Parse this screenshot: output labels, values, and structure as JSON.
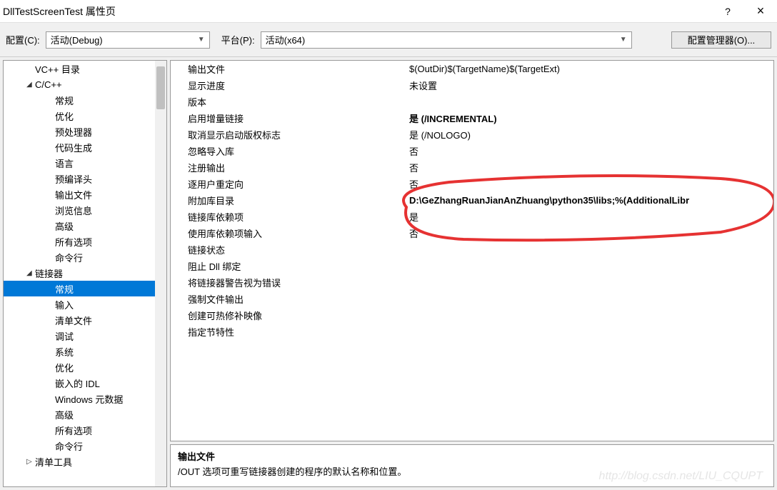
{
  "titlebar": {
    "title": "DllTestScreenTest 属性页",
    "help": "?",
    "close": "×"
  },
  "toolbar": {
    "config_label": "配置(C):",
    "config_value": "活动(Debug)",
    "platform_label": "平台(P):",
    "platform_value": "活动(x64)",
    "manager_button": "配置管理器(O)..."
  },
  "tree": [
    {
      "label": "VC++ 目录",
      "level": 1
    },
    {
      "label": "C/C++",
      "level": 1,
      "arrow": "◢"
    },
    {
      "label": "常规",
      "level": 3
    },
    {
      "label": "优化",
      "level": 3
    },
    {
      "label": "预处理器",
      "level": 3
    },
    {
      "label": "代码生成",
      "level": 3
    },
    {
      "label": "语言",
      "level": 3
    },
    {
      "label": "预编译头",
      "level": 3
    },
    {
      "label": "输出文件",
      "level": 3
    },
    {
      "label": "浏览信息",
      "level": 3
    },
    {
      "label": "高级",
      "level": 3
    },
    {
      "label": "所有选项",
      "level": 3
    },
    {
      "label": "命令行",
      "level": 3
    },
    {
      "label": "链接器",
      "level": 1,
      "arrow": "◢"
    },
    {
      "label": "常规",
      "level": 3,
      "selected": true
    },
    {
      "label": "输入",
      "level": 3
    },
    {
      "label": "清单文件",
      "level": 3
    },
    {
      "label": "调试",
      "level": 3
    },
    {
      "label": "系统",
      "level": 3
    },
    {
      "label": "优化",
      "level": 3
    },
    {
      "label": "嵌入的 IDL",
      "level": 3
    },
    {
      "label": "Windows 元数据",
      "level": 3
    },
    {
      "label": "高级",
      "level": 3
    },
    {
      "label": "所有选项",
      "level": 3
    },
    {
      "label": "命令行",
      "level": 3
    },
    {
      "label": "清单工具",
      "level": 1,
      "arrow": "▷"
    }
  ],
  "props": [
    {
      "label": "输出文件",
      "value": "$(OutDir)$(TargetName)$(TargetExt)"
    },
    {
      "label": "显示进度",
      "value": "未设置"
    },
    {
      "label": "版本",
      "value": ""
    },
    {
      "label": "启用增量链接",
      "value": "是 (/INCREMENTAL)",
      "bold": true
    },
    {
      "label": "取消显示启动版权标志",
      "value": "是 (/NOLOGO)"
    },
    {
      "label": "忽略导入库",
      "value": "否"
    },
    {
      "label": "注册输出",
      "value": "否"
    },
    {
      "label": "逐用户重定向",
      "value": "否"
    },
    {
      "label": "附加库目录",
      "value": "D:\\GeZhangRuanJianAnZhuang\\python35\\libs;%(AdditionalLibr",
      "bold": true
    },
    {
      "label": "链接库依赖项",
      "value": "是"
    },
    {
      "label": "使用库依赖项输入",
      "value": "否"
    },
    {
      "label": "链接状态",
      "value": ""
    },
    {
      "label": "阻止 Dll 绑定",
      "value": ""
    },
    {
      "label": "将链接器警告视为错误",
      "value": ""
    },
    {
      "label": "强制文件输出",
      "value": ""
    },
    {
      "label": "创建可热修补映像",
      "value": ""
    },
    {
      "label": "指定节特性",
      "value": ""
    }
  ],
  "desc": {
    "title": "输出文件",
    "text": "/OUT 选项可重写链接器创建的程序的默认名称和位置。"
  },
  "watermark": "http://blog.csdn.net/LIU_CQUPT"
}
